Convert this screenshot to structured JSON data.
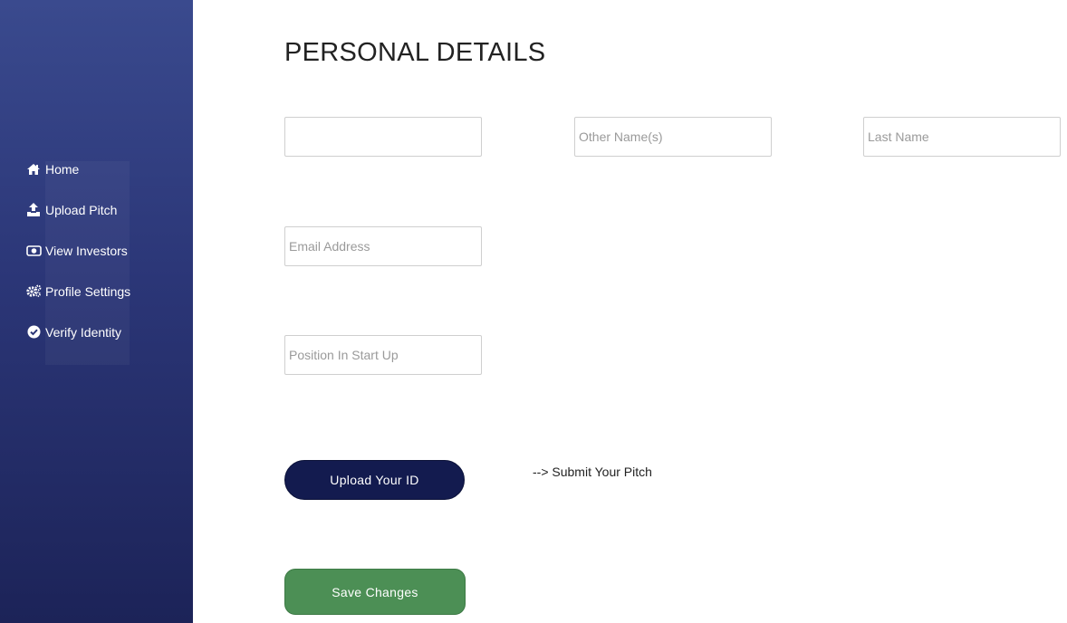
{
  "sidebar": {
    "items": [
      {
        "label": "Home",
        "icon": "home-icon"
      },
      {
        "label": "Upload Pitch",
        "icon": "upload-icon"
      },
      {
        "label": "View Investors",
        "icon": "money-bill-icon"
      },
      {
        "label": "Profile Settings",
        "icon": "gears-icon"
      },
      {
        "label": "Verify Identity",
        "icon": "check-circle-icon"
      }
    ]
  },
  "main": {
    "title": "PERSONAL DETAILS",
    "fields": {
      "first_name": {
        "value": "",
        "placeholder": ""
      },
      "other_names": {
        "value": "",
        "placeholder": "Other Name(s)"
      },
      "last_name": {
        "value": "",
        "placeholder": "Last Name"
      },
      "email": {
        "value": "",
        "placeholder": "Email Address"
      },
      "position": {
        "value": "",
        "placeholder": "Position In Start Up"
      }
    },
    "upload_id_label": "Upload Your ID",
    "submit_pitch_label": "--> Submit Your Pitch",
    "save_label": "Save Changes"
  },
  "colors": {
    "sidebar_top": "#3a4a8e",
    "sidebar_bottom": "#1c2358",
    "upload_button": "#131b4f",
    "save_button": "#4c8f55"
  }
}
